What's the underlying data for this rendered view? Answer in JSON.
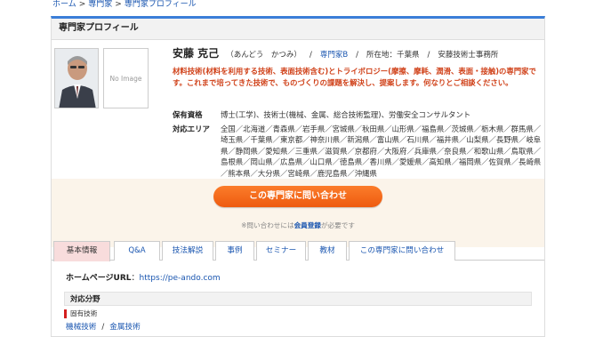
{
  "breadcrumb": {
    "home": "ホーム",
    "experts": "専門家",
    "current": "専門家プロフィール",
    "separator": ">"
  },
  "section_title": "専門家プロフィール",
  "no_image_label": "No Image",
  "profile": {
    "name": "安藤 克己",
    "reading": "（あんどう　かつみ）",
    "slash": "/",
    "badge": "専門家B",
    "location": "所在地：千葉県",
    "office": "安藤技術士事務所",
    "catchphrase": "材料技術(材料を利用する技術、表面技術含む)とトライボロジー(摩擦、摩耗、潤滑、表面・接触)の専門家です。これまで培ってきた技術で、ものづくりの課題を解決し、提案します。何なりとご相談ください。"
  },
  "info": {
    "qualification_label": "保有資格",
    "qualification_value": "博士(工学)、技術士(機械、金属、総合技術監理)、労働安全コンサルタント",
    "area_label": "対応エリア",
    "area_value": "全国／北海道／青森県／岩手県／宮城県／秋田県／山形県／福島県／茨城県／栃木県／群馬県／埼玉県／千葉県／東京都／神奈川県／新潟県／富山県／石川県／福井県／山梨県／長野県／岐阜県／静岡県／愛知県／三重県／滋賀県／京都府／大阪府／兵庫県／奈良県／和歌山県／鳥取県／島根県／岡山県／広島県／山口県／徳島県／香川県／愛媛県／高知県／福岡県／佐賀県／長崎県／熊本県／大分県／宮崎県／鹿児島県／沖縄県"
  },
  "contact": {
    "button_label": "この専門家に問い合わせ",
    "note_prefix": "※問い合わせには",
    "note_link": "会員登録",
    "note_suffix": "が必要です"
  },
  "tabs": [
    {
      "label": "基本情報",
      "active": true
    },
    {
      "label": "Q&A"
    },
    {
      "label": "技法解説"
    },
    {
      "label": "事例"
    },
    {
      "label": "セミナー"
    },
    {
      "label": "教材"
    },
    {
      "label": "この専門家に問い合わせ"
    }
  ],
  "homepage": {
    "label": "ホームページURL",
    "colon": "：",
    "url": "https://pe-ando.com"
  },
  "fields": {
    "heading": "対応分野",
    "subheading": "固有技術",
    "items": [
      "機械技術",
      "金属技術"
    ],
    "separator": "/"
  },
  "colors": {
    "accent_blue": "#3b7ed8",
    "link": "#1a56b0",
    "catch_text": "#d0421a",
    "button_orange": "#f36a1c",
    "active_tab": "#f8dcdc"
  }
}
